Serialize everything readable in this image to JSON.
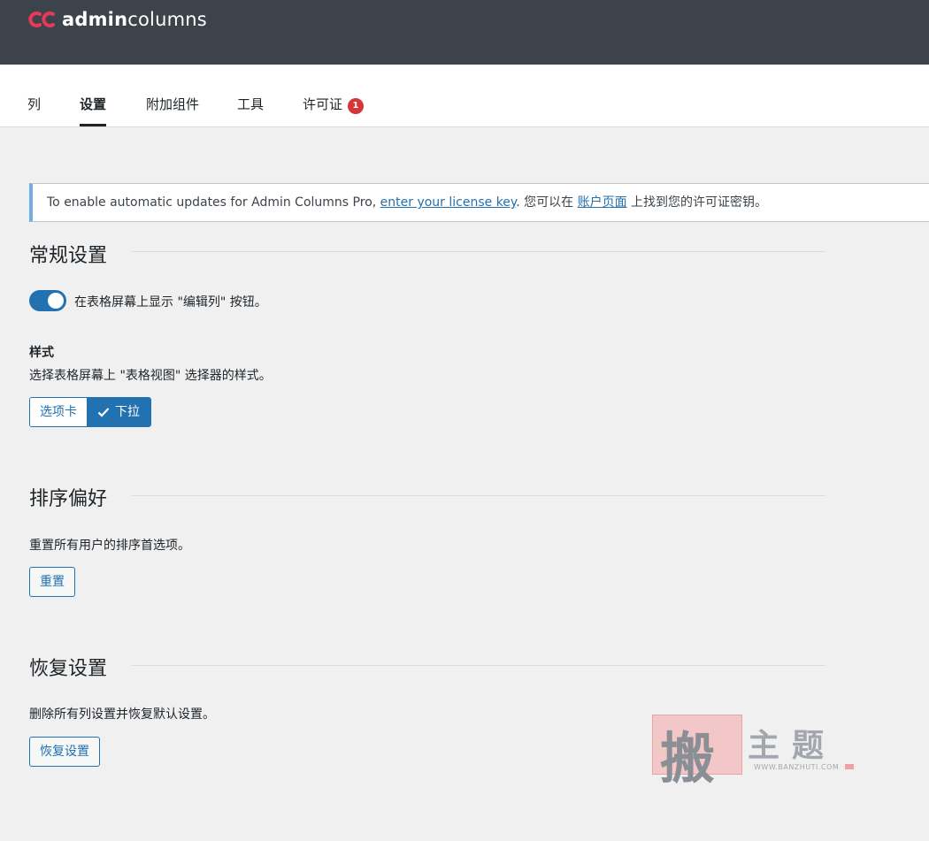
{
  "brand": {
    "name_bold": "admin",
    "name_regular": "columns"
  },
  "tabs": [
    {
      "label": "列"
    },
    {
      "label": "设置"
    },
    {
      "label": "附加组件"
    },
    {
      "label": "工具"
    },
    {
      "label": "许可证",
      "badge": "1"
    }
  ],
  "notice": {
    "text_before": "To enable automatic updates for Admin Columns Pro, ",
    "link1": "enter your license key",
    "text_middle": ". 您可以在 ",
    "link2": "账户页面",
    "text_after": " 上找到您的许可证密钥。"
  },
  "general": {
    "title": "常规设置",
    "toggle_label": "在表格屏幕上显示 \"编辑列\" 按钮。",
    "toggle_on": true,
    "style_heading": "样式",
    "style_desc": "选择表格屏幕上 \"表格视图\" 选择器的样式。",
    "style_options": [
      "选项卡",
      "下拉"
    ],
    "style_selected": "下拉"
  },
  "sorting": {
    "title": "排序偏好",
    "desc": "重置所有用户的排序首选项。",
    "button": "重置"
  },
  "restore": {
    "title": "恢复设置",
    "desc": "删除所有列设置并恢复默认设置。",
    "button": "恢复设置"
  },
  "watermark": {
    "seal_char": "搬",
    "chars": "主题",
    "url": "WWW.BANZHUTI.COM"
  },
  "colors": {
    "header_bg": "#3c434a",
    "accent": "#2271b1",
    "badge": "#d63638",
    "logo_red": "#e8395a"
  },
  "icons": {
    "check": "checkmark-icon",
    "logo": "admincolumns-logo-icon"
  }
}
